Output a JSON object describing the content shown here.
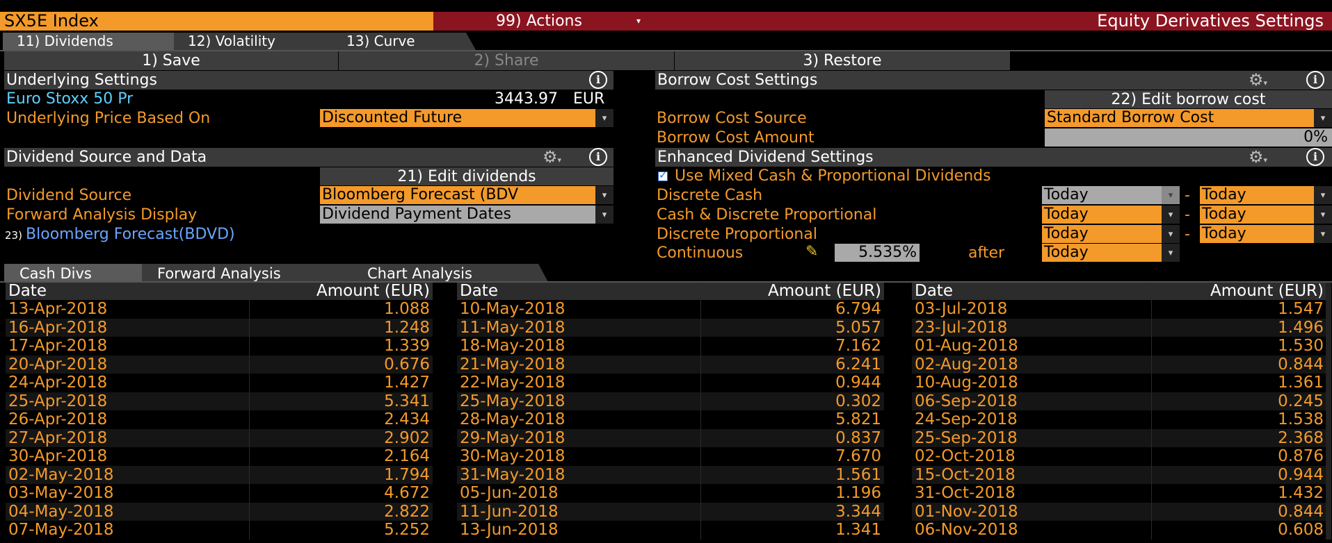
{
  "title_bar": {
    "ticker": "SX5E Index",
    "actions": "99) Actions",
    "settings_title": "Equity Derivatives Settings"
  },
  "tabs": [
    "11) Dividends",
    "12) Volatility",
    "13) Curve"
  ],
  "toolbar": {
    "save": "1) Save",
    "share": "2) Share",
    "restore": "3) Restore"
  },
  "underlying": {
    "header": "Underlying Settings",
    "name": "Euro Stoxx 50 Pr",
    "price": "3443.97",
    "currency": "EUR",
    "price_based_label": "Underlying Price Based On",
    "price_based_value": "Discounted Future"
  },
  "dividend_source": {
    "header": "Dividend Source and Data",
    "edit_button": "21) Edit dividends",
    "source_label": "Dividend Source",
    "source_value": "Bloomberg Forecast (BDV",
    "forward_label": "Forward Analysis Display",
    "forward_value": "Dividend Payment Dates",
    "link_prefix": "23)",
    "link_text": "Bloomberg Forecast(BDVD)"
  },
  "borrow": {
    "header": "Borrow Cost Settings",
    "edit_button": "22) Edit borrow cost",
    "source_label": "Borrow Cost Source",
    "source_value": "Standard Borrow Cost",
    "amount_label": "Borrow Cost Amount",
    "amount_value": "0%"
  },
  "enhanced": {
    "header": "Enhanced Dividend Settings",
    "checkbox_label": "Use Mixed Cash & Proportional Dividends",
    "checked": true,
    "rows": [
      {
        "label": "Discrete Cash",
        "from": "Today",
        "to": "Today"
      },
      {
        "label": "Cash & Discrete Proportional",
        "from": "Today",
        "to": "Today"
      },
      {
        "label": "Discrete Proportional",
        "from": "Today",
        "to": "Today"
      }
    ],
    "continuous_label": "Continuous",
    "continuous_value": "5.535%",
    "after_label": "after",
    "after_value": "Today",
    "dash": "-"
  },
  "bottom_tabs": [
    "Cash Divs",
    "Forward Analysis",
    "Chart Analysis"
  ],
  "table": {
    "col_date": "Date",
    "col_amount": "Amount (EUR)",
    "columns": [
      [
        [
          "13-Apr-2018",
          "1.088"
        ],
        [
          "16-Apr-2018",
          "1.248"
        ],
        [
          "17-Apr-2018",
          "1.339"
        ],
        [
          "20-Apr-2018",
          "0.676"
        ],
        [
          "24-Apr-2018",
          "1.427"
        ],
        [
          "25-Apr-2018",
          "5.341"
        ],
        [
          "26-Apr-2018",
          "2.434"
        ],
        [
          "27-Apr-2018",
          "2.902"
        ],
        [
          "30-Apr-2018",
          "2.164"
        ],
        [
          "02-May-2018",
          "1.794"
        ],
        [
          "03-May-2018",
          "4.672"
        ],
        [
          "04-May-2018",
          "2.822"
        ],
        [
          "07-May-2018",
          "5.252"
        ]
      ],
      [
        [
          "10-May-2018",
          "6.794"
        ],
        [
          "11-May-2018",
          "5.057"
        ],
        [
          "18-May-2018",
          "7.162"
        ],
        [
          "21-May-2018",
          "6.241"
        ],
        [
          "22-May-2018",
          "0.944"
        ],
        [
          "25-May-2018",
          "0.302"
        ],
        [
          "28-May-2018",
          "5.821"
        ],
        [
          "29-May-2018",
          "0.837"
        ],
        [
          "30-May-2018",
          "7.670"
        ],
        [
          "31-May-2018",
          "1.561"
        ],
        [
          "05-Jun-2018",
          "1.196"
        ],
        [
          "11-Jun-2018",
          "3.344"
        ],
        [
          "13-Jun-2018",
          "1.341"
        ]
      ],
      [
        [
          "03-Jul-2018",
          "1.547"
        ],
        [
          "23-Jul-2018",
          "1.496"
        ],
        [
          "01-Aug-2018",
          "1.530"
        ],
        [
          "02-Aug-2018",
          "0.844"
        ],
        [
          "10-Aug-2018",
          "1.361"
        ],
        [
          "06-Sep-2018",
          "0.245"
        ],
        [
          "24-Sep-2018",
          "1.538"
        ],
        [
          "25-Sep-2018",
          "2.368"
        ],
        [
          "02-Oct-2018",
          "0.876"
        ],
        [
          "15-Oct-2018",
          "0.944"
        ],
        [
          "31-Oct-2018",
          "1.432"
        ],
        [
          "01-Nov-2018",
          "0.844"
        ],
        [
          "06-Nov-2018",
          "0.608"
        ]
      ]
    ]
  },
  "colors": {
    "orange": "#f39a2b",
    "maroon": "#8b1421",
    "cyan": "#5ed0ff"
  }
}
